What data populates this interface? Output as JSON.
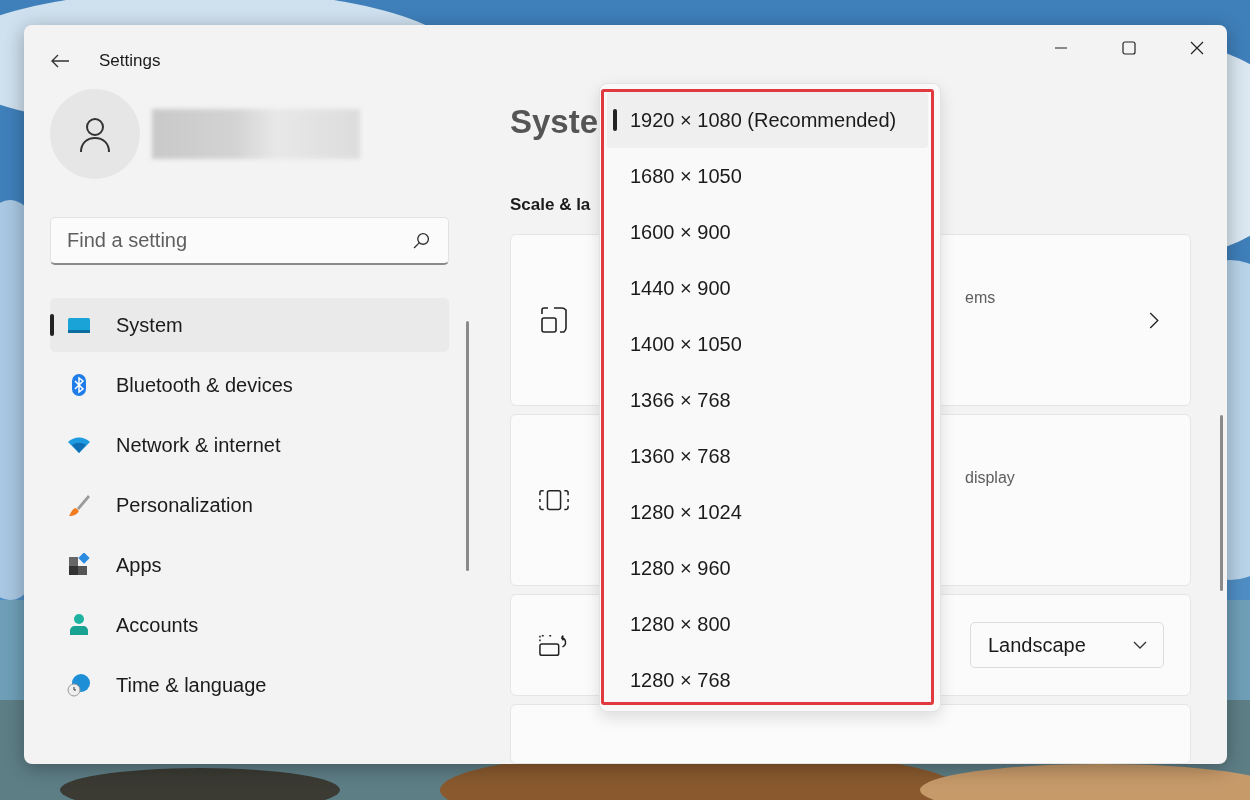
{
  "window": {
    "title": "Settings"
  },
  "search": {
    "placeholder": "Find a setting"
  },
  "nav": [
    {
      "label": "System",
      "kind": "system",
      "selected": true
    },
    {
      "label": "Bluetooth & devices",
      "kind": "bluetooth",
      "selected": false
    },
    {
      "label": "Network & internet",
      "kind": "network",
      "selected": false
    },
    {
      "label": "Personalization",
      "kind": "brush",
      "selected": false
    },
    {
      "label": "Apps",
      "kind": "apps",
      "selected": false
    },
    {
      "label": "Accounts",
      "kind": "accounts",
      "selected": false
    },
    {
      "label": "Time & language",
      "kind": "time",
      "selected": false
    }
  ],
  "page": {
    "heading": "Syste",
    "section": "Scale & la"
  },
  "cards": [
    {
      "kind": "link",
      "text": "ems"
    },
    {
      "kind": "plain",
      "text": "display"
    },
    {
      "kind": "select",
      "value": "Landscape"
    },
    {
      "kind": "empty"
    }
  ],
  "resolution_menu": {
    "options": [
      {
        "label": "1920 × 1080 (Recommended)",
        "selected": true
      },
      {
        "label": "1680 × 1050",
        "selected": false
      },
      {
        "label": "1600 × 900",
        "selected": false
      },
      {
        "label": "1440 × 900",
        "selected": false
      },
      {
        "label": "1400 × 1050",
        "selected": false
      },
      {
        "label": "1366 × 768",
        "selected": false
      },
      {
        "label": "1360 × 768",
        "selected": false
      },
      {
        "label": "1280 × 1024",
        "selected": false
      },
      {
        "label": "1280 × 960",
        "selected": false
      },
      {
        "label": "1280 × 800",
        "selected": false
      },
      {
        "label": "1280 × 768",
        "selected": false
      }
    ]
  }
}
